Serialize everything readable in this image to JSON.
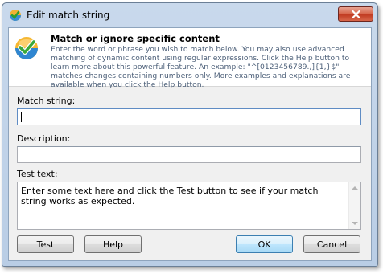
{
  "window": {
    "title": "Edit match string",
    "close_icon": "close-icon"
  },
  "header": {
    "title": "Match or ignore specific content",
    "description": "Enter the word or phrase you wish to match below. You may also use advanced matching of dynamic content using regular expressions. Click the Help button to learn more about this powerful feature. An example: \"^[0123456789.,]{1,}$\" matches changes containing numbers only. More examples and explanations are available when you click the Help button."
  },
  "fields": {
    "match_string_label": "Match string:",
    "match_string_value": "",
    "description_label": "Description:",
    "description_value": "",
    "test_text_label": "Test text:",
    "test_text_value": "Enter some text here and click the Test button to see if your match string works as expected."
  },
  "buttons": {
    "test": "Test",
    "help": "Help",
    "ok": "OK",
    "cancel": "Cancel"
  },
  "colors": {
    "header_text": "#4d6079",
    "close_button": "#c13b22",
    "default_button_border": "#3c7fb1"
  }
}
